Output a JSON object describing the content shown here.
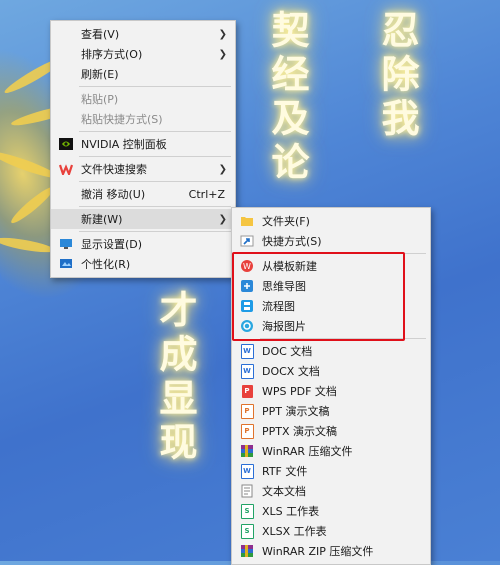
{
  "wallpaper": {
    "column1": "契经及论",
    "column2": "忍除我",
    "column3": "才成显现"
  },
  "context_menu": {
    "items": [
      {
        "label": "查看(V)",
        "submenu": true
      },
      {
        "label": "排序方式(O)",
        "submenu": true
      },
      {
        "label": "刷新(E)"
      },
      {
        "label": "粘贴(P)",
        "disabled": true
      },
      {
        "label": "粘贴快捷方式(S)",
        "disabled": true
      },
      {
        "label": "NVIDIA 控制面板",
        "icon": "nvidia-icon"
      },
      {
        "label": "文件快速搜索",
        "icon": "wps-icon",
        "submenu": true
      },
      {
        "label": "撤消 移动(U)",
        "shortcut": "Ctrl+Z"
      },
      {
        "label": "新建(W)",
        "submenu": true,
        "highlighted": true
      },
      {
        "label": "显示设置(D)",
        "icon": "display-icon"
      },
      {
        "label": "个性化(R)",
        "icon": "personalize-icon"
      }
    ]
  },
  "new_submenu": {
    "items": [
      {
        "label": "文件夹(F)",
        "icon": "folder-icon"
      },
      {
        "label": "快捷方式(S)",
        "icon": "shortcut-icon"
      },
      {
        "label": "从模板新建",
        "icon": "template-icon"
      },
      {
        "label": "思维导图",
        "icon": "mindmap-icon"
      },
      {
        "label": "流程图",
        "icon": "flowchart-icon"
      },
      {
        "label": "海报图片",
        "icon": "poster-icon"
      },
      {
        "label": "DOC 文档",
        "icon": "doc-icon"
      },
      {
        "label": "DOCX 文档",
        "icon": "docx-icon"
      },
      {
        "label": "WPS PDF 文档",
        "icon": "pdf-icon"
      },
      {
        "label": "PPT 演示文稿",
        "icon": "ppt-icon"
      },
      {
        "label": "PPTX 演示文稿",
        "icon": "pptx-icon"
      },
      {
        "label": "WinRAR 压缩文件",
        "icon": "winrar-icon"
      },
      {
        "label": "RTF 文件",
        "icon": "rtf-icon"
      },
      {
        "label": "文本文档",
        "icon": "txt-icon"
      },
      {
        "label": "XLS 工作表",
        "icon": "xls-icon"
      },
      {
        "label": "XLSX 工作表",
        "icon": "xlsx-icon"
      },
      {
        "label": "WinRAR ZIP 压缩文件",
        "icon": "winrar-zip-icon"
      }
    ]
  },
  "colors": {
    "highlight_box": "#e0101a",
    "menu_bg": "#f2f2f2",
    "wps_red": "#e8413c",
    "word_blue": "#2b6fd6",
    "excel_green": "#21a366",
    "ppt_orange": "#e0732c"
  }
}
